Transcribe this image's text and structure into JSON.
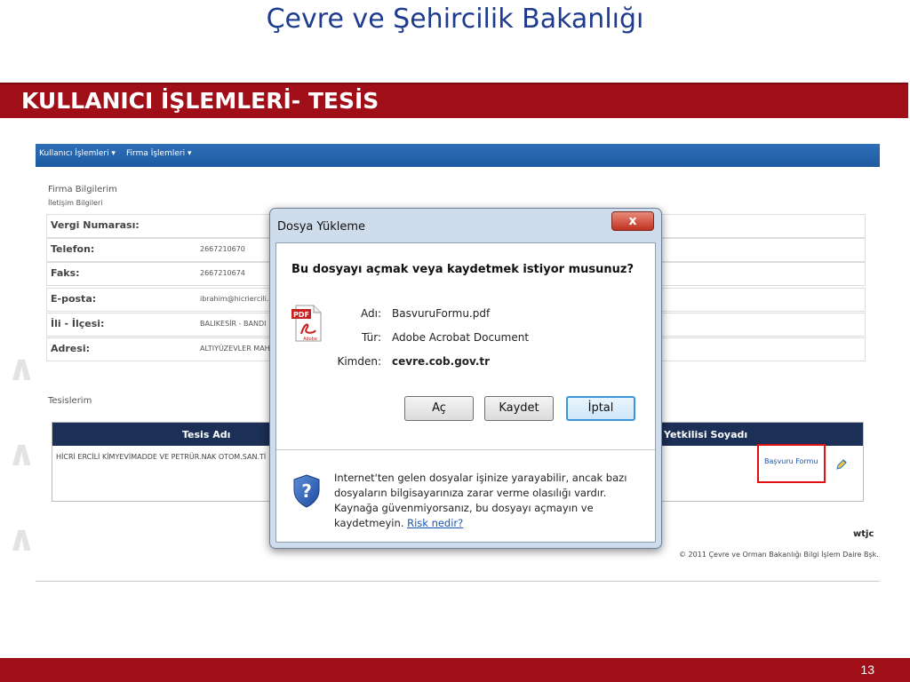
{
  "slide": {
    "title": "Çevre ve Şehircilik Bakanlığı",
    "section": "KULLANICI İŞLEMLERİ- TESİS",
    "page_number": "13"
  },
  "app": {
    "nav": [
      "Kullanıcı İşlemleri ▾",
      "Firma İşlemleri ▾"
    ],
    "firma_heading": "Firma Bilgilerim",
    "iletisim_heading": "İletişim Bilgileri",
    "fields": [
      {
        "label": "Vergi Numarası:",
        "value": ""
      },
      {
        "label": "Telefon:",
        "value": "2667210670"
      },
      {
        "label": "Faks:",
        "value": "2667210674"
      },
      {
        "label": "E-posta:",
        "value": "ibrahim@hicriercili.c"
      },
      {
        "label": "İli - İlçesi:",
        "value": "BALIKESİR - BANDI"
      },
      {
        "label": "Adresi:",
        "value": "ALTIYÜZEVLER MAH"
      }
    ],
    "tesis_heading": "Tesislerim",
    "table_headers": [
      "Tesis Adı",
      "Yetkilisi Soyadı"
    ],
    "table_row": "HİCRİ ERCİLİ KİMYEVİMADDE VE PETRÜR.NAK OTOM.SAN.Tİ",
    "basvuru_link": "Başvuru Formu",
    "brand": "wtjc",
    "copyright": "© 2011 Çevre ve Orman Bakanlığı Bilgi İşlem Daire Bşk."
  },
  "dialog": {
    "title": "Dosya Yükleme",
    "close_symbol": "x",
    "question": "Bu dosyayı açmak veya kaydetmek istiyor musunuz?",
    "file": {
      "name_label": "Adı:",
      "name": "BasvuruFormu.pdf",
      "type_label": "Tür:",
      "type": "Adobe Acrobat Document",
      "from_label": "Kimden:",
      "from": "cevre.cob.gov.tr"
    },
    "buttons": {
      "open": "Aç",
      "save": "Kaydet",
      "cancel": "İptal"
    },
    "warning": "Internet'ten gelen dosyalar işinize yarayabilir, ancak bazı dosyaların bilgisayarınıza zarar verme olasılığı vardır. Kaynağa güvenmiyorsanız, bu dosyayı açmayın ve kaydetmeyin.",
    "risk_link": "Risk nedir?",
    "pdf_icon_text": "Adobe",
    "pdf_badge": "PDF"
  },
  "colors": {
    "title_blue": "#1f3b8f",
    "bar_red": "#a00f17",
    "nav_blue": "#1d5aa0",
    "table_header": "#1c2f56",
    "highlight_red": "#e01010"
  },
  "icons": {
    "pdf": "pdf-file-icon",
    "shield": "shield-question-icon",
    "edit": "edit-icon",
    "close": "close-icon"
  }
}
